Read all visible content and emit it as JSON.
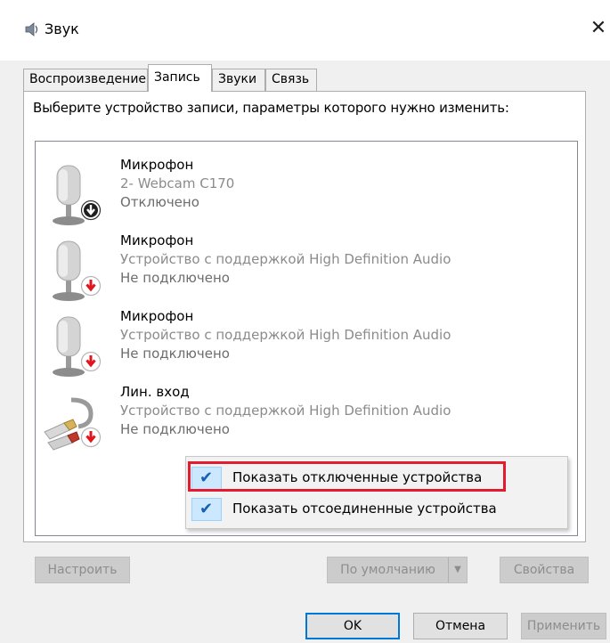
{
  "window": {
    "title": "Звук",
    "close_glyph": "✕"
  },
  "tabs": [
    {
      "label": "Воспроизведение",
      "active": false
    },
    {
      "label": "Запись",
      "active": true
    },
    {
      "label": "Звуки",
      "active": false
    },
    {
      "label": "Связь",
      "active": false
    }
  ],
  "instruction": "Выберите устройство записи, параметры которого нужно изменить:",
  "devices": [
    {
      "name": "Микрофон",
      "description": "2- Webcam C170",
      "status": "Отключено",
      "icon": "microphone-icon",
      "badge": "disabled-arrow-black"
    },
    {
      "name": "Микрофон",
      "description": "Устройство с поддержкой High Definition Audio",
      "status": "Не подключено",
      "icon": "microphone-icon",
      "badge": "unplugged-arrow-red"
    },
    {
      "name": "Микрофон",
      "description": "Устройство с поддержкой High Definition Audio",
      "status": "Не подключено",
      "icon": "microphone-icon",
      "badge": "unplugged-arrow-red"
    },
    {
      "name": "Лин. вход",
      "description": "Устройство с поддержкой High Definition Audio",
      "status": "Не подключено",
      "icon": "line-in-cable-icon",
      "badge": "unplugged-arrow-red"
    }
  ],
  "context_menu": [
    {
      "label": "Показать отключенные устройства",
      "checked": true,
      "check_glyph": "✔"
    },
    {
      "label": "Показать отсоединенные устройства",
      "checked": true,
      "check_glyph": "✔"
    }
  ],
  "buttons": {
    "configure": "Настроить",
    "set_default": "По умолчанию",
    "properties": "Свойства",
    "ok": "OK",
    "cancel": "Отмена",
    "apply": "Применить"
  },
  "colors": {
    "highlight": "#e21b2f",
    "accent": "#0078d7",
    "menu_check_bg": "#cce8ff"
  }
}
